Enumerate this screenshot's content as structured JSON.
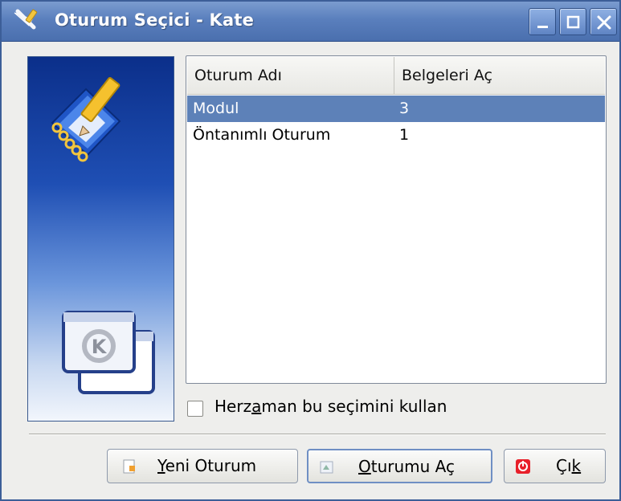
{
  "window": {
    "title": "Oturum Seçici - Kate",
    "controls": [
      "minimize-icon",
      "maximize-icon",
      "close-icon"
    ]
  },
  "side_panel": {
    "icons": [
      "kate-notebook-pencil-icon",
      "kde-window-logo-icon"
    ]
  },
  "sessions_table": {
    "headers": [
      "Oturum Adı",
      "Belgeleri Aç"
    ],
    "rows": [
      {
        "name": "Modul",
        "documents": "3",
        "selected": true
      },
      {
        "name": "Öntanımlı Oturum",
        "documents": "1",
        "selected": false
      }
    ]
  },
  "always_use_checkbox": {
    "label_pre": "Herz",
    "label_mnemonic": "a",
    "label_post": "man bu seçimini kullan",
    "checked": false
  },
  "buttons": {
    "new_session": {
      "mnemonic": "Y",
      "rest": "eni Oturum",
      "icon": "new-document-icon"
    },
    "open_session": {
      "mnemonic": "O",
      "rest": "turumu Aç",
      "icon": "open-session-icon"
    },
    "quit": {
      "pre": "Çı",
      "mnemonic": "k",
      "icon": "quit-icon"
    }
  },
  "colors": {
    "titlebar": "#5a7fbd",
    "selection": "#5d81b8",
    "quit_icon": "#e8202a"
  }
}
